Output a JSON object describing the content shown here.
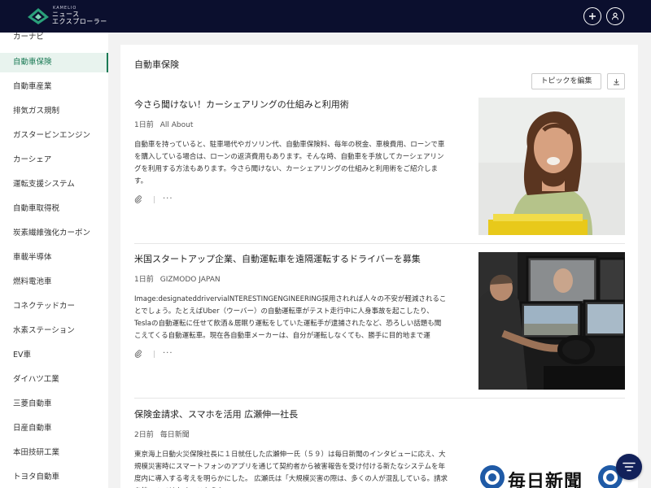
{
  "header": {
    "logo_sub": "KAMELIO",
    "logo_line1": "ニュース",
    "logo_line2": "エクスプローラー"
  },
  "sidebar": {
    "items": [
      {
        "label": "カーナビ"
      },
      {
        "label": "自動車保険",
        "active": true
      },
      {
        "label": "自動車産業"
      },
      {
        "label": "排気ガス規制"
      },
      {
        "label": "ガスタービンエンジン"
      },
      {
        "label": "カーシェア"
      },
      {
        "label": "運転支援システム"
      },
      {
        "label": "自動車取得税"
      },
      {
        "label": "炭素繊維強化カーボン"
      },
      {
        "label": "車載半導体"
      },
      {
        "label": "燃料電池車"
      },
      {
        "label": "コネクテッドカー"
      },
      {
        "label": "水素ステーション"
      },
      {
        "label": "EV車"
      },
      {
        "label": "ダイハツ工業"
      },
      {
        "label": "三菱自動車"
      },
      {
        "label": "日産自動車"
      },
      {
        "label": "本田技研工業"
      },
      {
        "label": "トヨタ自動車"
      }
    ]
  },
  "main": {
    "title": "自動車保険",
    "edit_button": "トピックを編集",
    "articles": [
      {
        "title": "今さら聞けない！カーシェアリングの仕組みと利用術",
        "age": "1日前",
        "source": "All About",
        "body": "自動車を持っていると、駐車場代やガソリン代、自動車保険料、毎年の税金、車検費用、ローンで車を購入している場合は、ローンの返済費用もあります。そんな時、自動車を手放してカーシェアリングを利用する方法もあります。今さら聞けない、カーシェアリングの仕組みと利用術をご紹介します。"
      },
      {
        "title": "米国スタートアップ企業、自動運転車を遠隔運転するドライバーを募集",
        "age": "1日前",
        "source": "GIZMODO JAPAN",
        "body": "Image:designateddrivervialNTERESTINGENGINEERING採用されれば人々の不安が軽減されることでしょう。たとえばUber（ウーバー）の自動運転車がテスト走行中に人身事故を起こしたり、Teslaの自動運転に任せて飲酒＆居眠り運転をしていた運転手が逮捕されたなど、恐ろしい話題も聞こえてくる自動運転車。現在各自動車メーカーは、自分が運転しなくても、勝手に目的地まで運"
      },
      {
        "title": "保険金請求、スマホを活用 広瀬伸一社長",
        "age": "2日前",
        "source": "毎日新聞",
        "body": "東京海上日動火災保険社長に１日就任した広瀬伸一氏（５９）は毎日新聞のインタビューに応え、大規模災害時にスマートフォンのアプリを通じて契約者から被害報告を受け付ける新たなシステムを年度内に導入する考えを明らかにした。 広瀬氏は「大規模災害の際は、多くの人が混乱している。請求を待つのではなく、こちらか",
        "image_text": "毎日新聞"
      }
    ]
  }
}
